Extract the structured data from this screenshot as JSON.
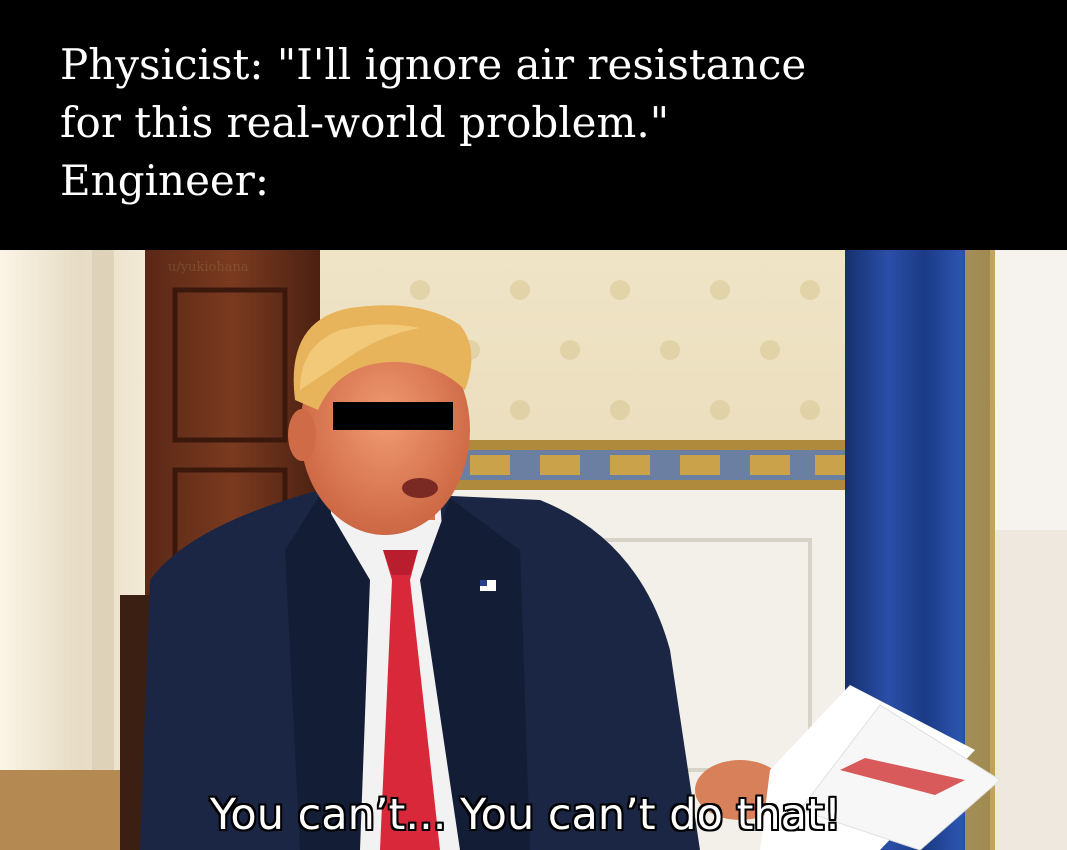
{
  "caption": {
    "lines": [
      "Physicist: \"I'll ignore air resistance",
      "for this real-world problem.\"",
      "Engineer:"
    ]
  },
  "scene": {
    "watermark": "u/yukiohana",
    "subtitle": "You can’t... You can’t do that!",
    "colors": {
      "wall": "#e8dcbd",
      "curtain_blue": "#1f3f8f",
      "suit": "#1a2540",
      "tie": "#d8283a",
      "skin": "#e58a66",
      "hair": "#e7b35b",
      "censor_bar": "#000000"
    }
  }
}
